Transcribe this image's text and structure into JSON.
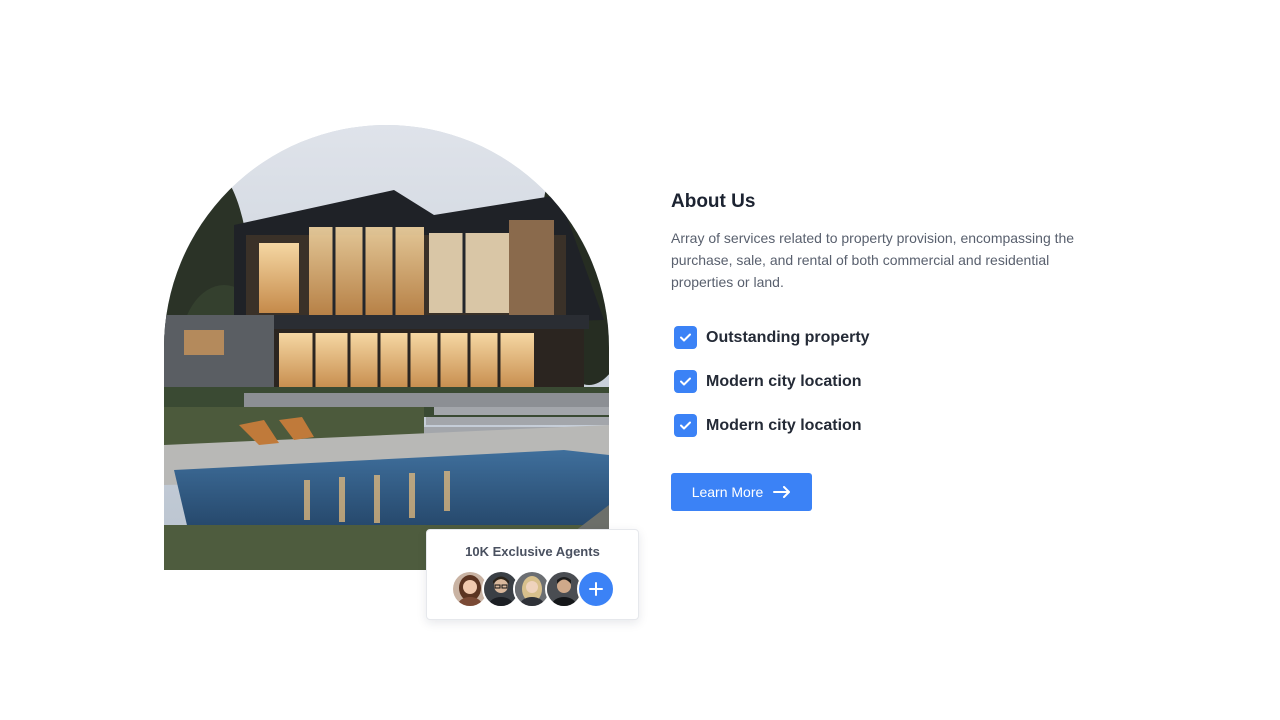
{
  "about": {
    "title": "About Us",
    "description": "Array of services related to property provision, encompassing the purchase, sale, and rental of both commercial and residential properties or land."
  },
  "features": [
    {
      "label": "Outstanding property",
      "checked": true
    },
    {
      "label": "Modern city location",
      "checked": true
    },
    {
      "label": "Modern city location",
      "checked": true
    }
  ],
  "cta": {
    "label": "Learn More",
    "icon": "arrow-right-icon"
  },
  "agents_card": {
    "title": "10K Exclusive Agents",
    "add_icon": "plus-icon"
  },
  "colors": {
    "accent": "#3b82f6",
    "heading": "#1c2331",
    "body_text": "#59606e"
  }
}
